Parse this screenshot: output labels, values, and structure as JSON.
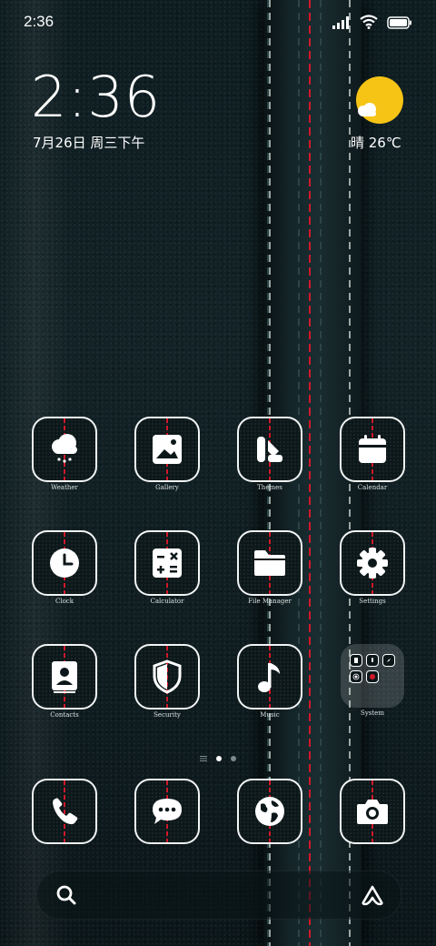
{
  "status_bar": {
    "time": "2:36"
  },
  "clock_widget": {
    "time": "2:36",
    "date": "7月26日 周三下午"
  },
  "weather_widget": {
    "text": "晴 26℃"
  },
  "apps_row1": [
    {
      "label": "Weather",
      "icon": "weather-icon"
    },
    {
      "label": "Gallery",
      "icon": "gallery-icon"
    },
    {
      "label": "Themes",
      "icon": "themes-icon"
    },
    {
      "label": "Calendar",
      "icon": "calendar-icon"
    }
  ],
  "apps_row2": [
    {
      "label": "Clock",
      "icon": "clock-icon"
    },
    {
      "label": "Calculator",
      "icon": "calculator-icon"
    },
    {
      "label": "File Manager",
      "icon": "folder-icon"
    },
    {
      "label": "Settings",
      "icon": "gear-icon"
    }
  ],
  "apps_row3": [
    {
      "label": "Contacts",
      "icon": "contacts-icon"
    },
    {
      "label": "Security",
      "icon": "shield-icon"
    },
    {
      "label": "Music",
      "icon": "music-note-icon"
    },
    {
      "label": "System",
      "icon": "folder-group-icon"
    }
  ],
  "dock": [
    {
      "name": "phone",
      "icon": "phone-icon"
    },
    {
      "name": "messages",
      "icon": "message-icon"
    },
    {
      "name": "browser",
      "icon": "globe-icon"
    },
    {
      "name": "camera",
      "icon": "camera-icon"
    }
  ],
  "colors": {
    "accent_red": "#d3182a",
    "sun_yellow": "#f6c415"
  }
}
